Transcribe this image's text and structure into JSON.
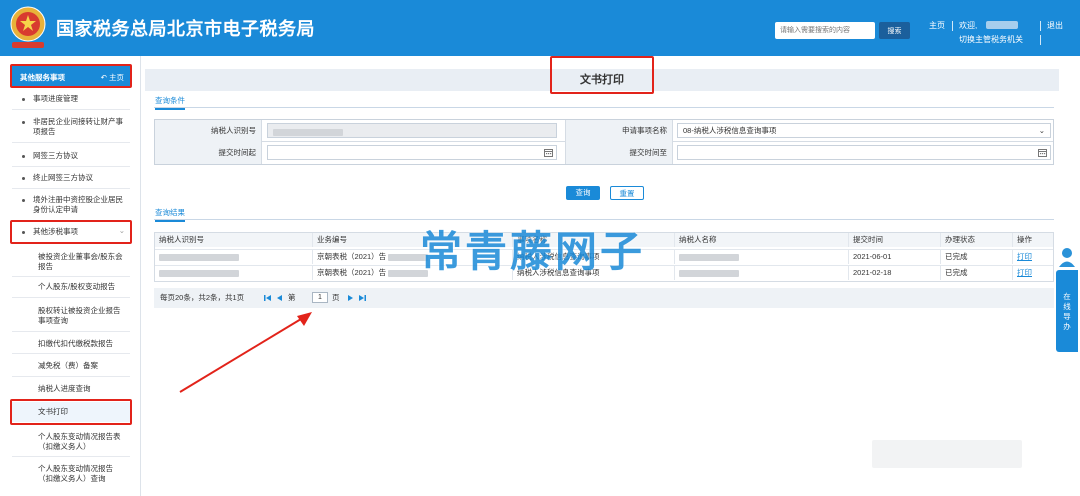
{
  "header": {
    "site_title": "国家税务总局北京市电子税务局",
    "search_placeholder": "请输入需要搜索的内容",
    "search_button": "搜索",
    "home": "主页",
    "welcome": "欢迎,",
    "switch_agency": "切换主管税务机关",
    "logout": "退出"
  },
  "sidebar": {
    "section_title": "其他服务事项",
    "home_link": "主页",
    "items": [
      "事项进度管理",
      "非居民企业间接转让财产事项报告",
      "网签三方协议",
      "终止网签三方协议",
      "境外注册中资控股企业居民身份认定申请",
      "其他涉税事项"
    ],
    "sub_items": [
      "被投资企业董事会/股东会报告",
      "个人股东/股权变动报告",
      "股权转让被投资企业报告事项查询",
      "扣缴代扣代缴税款报告",
      "减免税（费）备案",
      "纳税人进度查询",
      "文书打印",
      "个人股东变动情况报告表（扣缴义务人）",
      "个人股东变动情况报告（扣缴义务人）查询"
    ]
  },
  "main": {
    "page_title": "文书打印",
    "query_tab": "查询条件",
    "form": {
      "taxpayer_id_label": "纳税人识别号",
      "apply_item_label": "申请事项名称",
      "apply_item_value": "08-纳税人涉税信息查询事项",
      "submit_start_label": "提交时间起",
      "submit_end_label": "提交时间至"
    },
    "query_button": "查询",
    "reset_button": "重置",
    "result_tab": "查询结果",
    "table": {
      "headers": [
        "纳税人识别号",
        "业务编号",
        "事项名称",
        "纳税人名称",
        "提交时间",
        "办理状态",
        "操作"
      ],
      "rows": [
        {
          "biz_no": "京朝表税（2021）告",
          "item": "纳税人涉税信息查询事项",
          "time": "2021-06-01",
          "status": "已完成",
          "action": "打印"
        },
        {
          "biz_no": "京朝表税（2021）告",
          "item": "纳税人涉税信息查询事项",
          "time": "2021-02-18",
          "status": "已完成",
          "action": "打印"
        }
      ]
    },
    "pager": {
      "summary": "每页20条，共2条，共1页",
      "page_prefix": "第",
      "page_value": "1",
      "page_suffix": "页"
    }
  },
  "watermark": "常青藤网子",
  "right_tab": "在线导办",
  "colors": {
    "brand": "#1a8ad8",
    "highlight": "#e2231a"
  }
}
